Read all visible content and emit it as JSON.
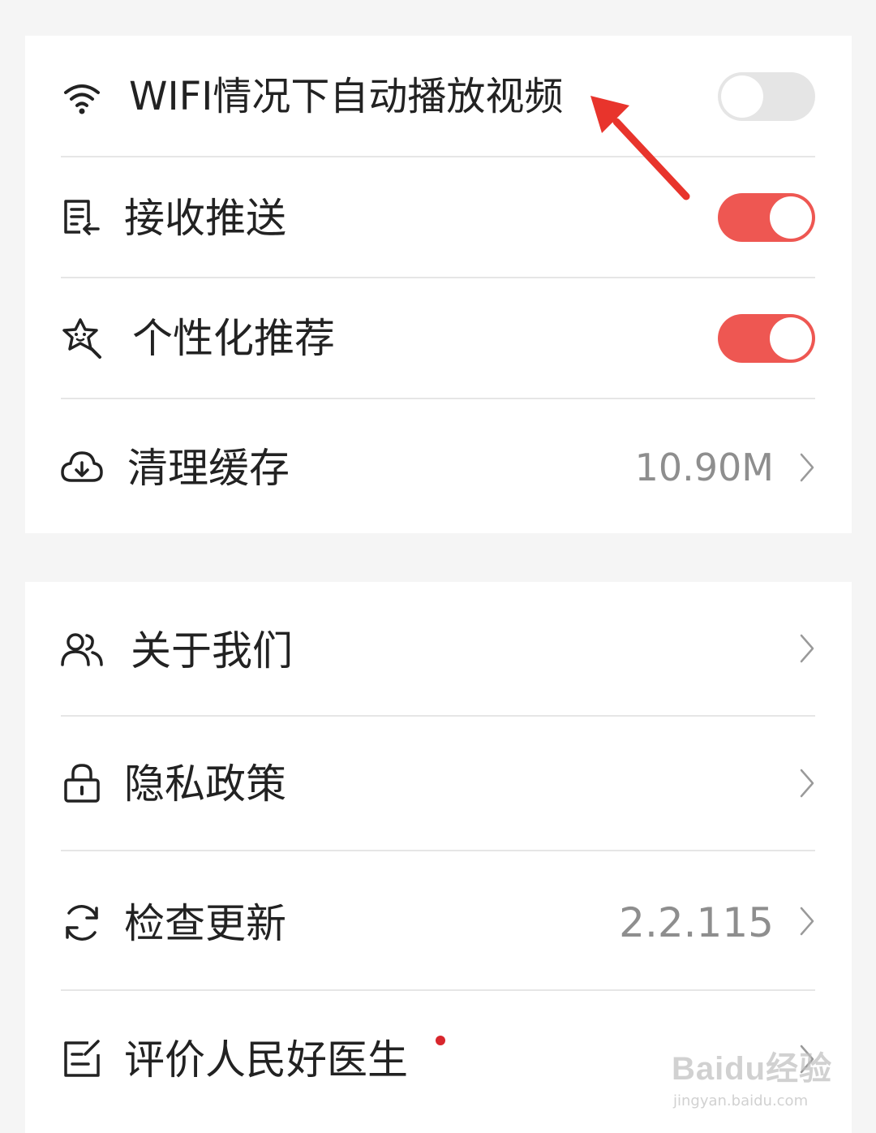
{
  "settings_group_1": {
    "items": [
      {
        "label": "WIFI情况下自动播放视频",
        "icon": "wifi-icon",
        "toggle": "off"
      },
      {
        "label": "接收推送",
        "icon": "push-document-icon",
        "toggle": "on"
      },
      {
        "label": "个性化推荐",
        "icon": "star-face-icon",
        "toggle": "on"
      },
      {
        "label": "清理缓存",
        "icon": "cloud-download-icon",
        "value": "10.90M"
      }
    ]
  },
  "settings_group_2": {
    "items": [
      {
        "label": "关于我们",
        "icon": "users-icon"
      },
      {
        "label": "隐私政策",
        "icon": "lock-icon"
      },
      {
        "label": "检查更新",
        "icon": "refresh-icon",
        "value": "2.2.115"
      },
      {
        "label": "评价人民好医生",
        "icon": "edit-note-icon",
        "badge": "red-dot"
      }
    ]
  },
  "colors": {
    "toggle_on": "#ee5752",
    "toggle_off": "#e5e5e5",
    "badge": "#d8262d",
    "arrow": "#e8342c"
  },
  "watermark": {
    "main": "Baidu经验",
    "url": "jingyan.baidu.com"
  }
}
